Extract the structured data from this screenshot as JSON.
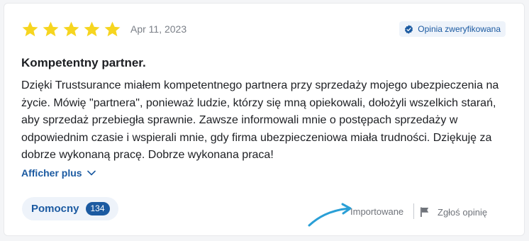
{
  "review": {
    "rating": 5,
    "max_rating": 5,
    "date": "Apr 11, 2023",
    "verified_label": "Opinia zweryfikowana",
    "title": "Kompetentny partner.",
    "body": "Dzięki Trustsurance miałem kompetentnego partnera przy sprzedaży mojego ubezpieczenia na życie. Mówię \"partnera\", ponieważ ludzie, którzy się mną opiekowali, dołożyli wszelkich starań, aby sprzedaż przebiegła sprawnie. Zawsze informowali mnie o postępach sprzedaży w odpowiednim czasie i wspierali mnie, gdy firma ubezpieczeniowa miała trudności. Dziękuję za dobrze wykonaną pracę. Dobrze wykonana praca!",
    "show_more_label": "Afficher plus"
  },
  "footer": {
    "helpful_label": "Pomocny",
    "helpful_count": "134",
    "imported_label": "Importowane",
    "report_label": "Zgłoś opinię"
  },
  "icons": {
    "star": "star-icon",
    "verified": "verified-badge-icon",
    "chevron": "chevron-down-icon",
    "arrow": "curved-arrow-icon",
    "flag": "flag-icon"
  },
  "colors": {
    "star": "#f6d51f",
    "accent": "#1b5aa1",
    "arrow": "#2a9fd6",
    "muted": "#6f737a"
  }
}
